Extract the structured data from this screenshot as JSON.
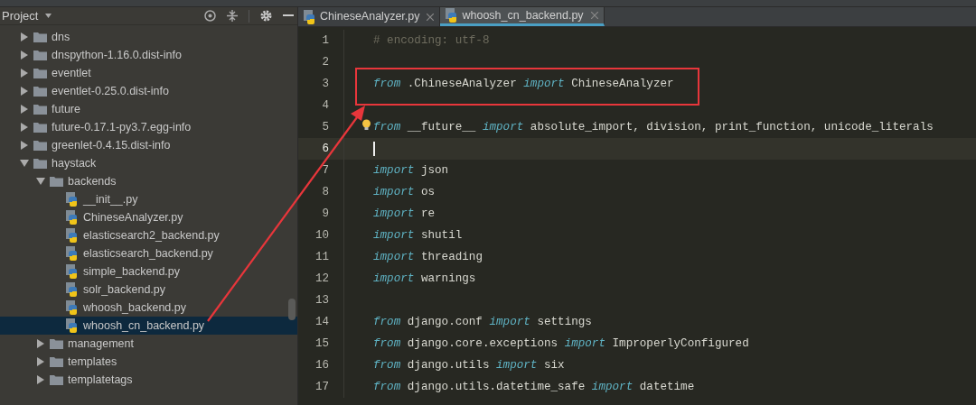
{
  "project_panel": {
    "title": "Project",
    "tree": [
      {
        "label": "dns",
        "kind": "folder",
        "expanded": false
      },
      {
        "label": "dnspython-1.16.0.dist-info",
        "kind": "folder",
        "expanded": false
      },
      {
        "label": "eventlet",
        "kind": "folder",
        "expanded": false
      },
      {
        "label": "eventlet-0.25.0.dist-info",
        "kind": "folder",
        "expanded": false
      },
      {
        "label": "future",
        "kind": "folder",
        "expanded": false
      },
      {
        "label": "future-0.17.1-py3.7.egg-info",
        "kind": "folder",
        "expanded": false
      },
      {
        "label": "greenlet-0.4.15.dist-info",
        "kind": "folder",
        "expanded": false
      },
      {
        "label": "haystack",
        "kind": "folder",
        "expanded": true,
        "children": [
          {
            "label": "backends",
            "kind": "folder",
            "expanded": true,
            "children": [
              {
                "label": "__init__.py",
                "kind": "python",
                "selected": false
              },
              {
                "label": "ChineseAnalyzer.py",
                "kind": "python",
                "selected": false
              },
              {
                "label": "elasticsearch2_backend.py",
                "kind": "python",
                "selected": false
              },
              {
                "label": "elasticsearch_backend.py",
                "kind": "python",
                "selected": false
              },
              {
                "label": "simple_backend.py",
                "kind": "python",
                "selected": false
              },
              {
                "label": "solr_backend.py",
                "kind": "python",
                "selected": false
              },
              {
                "label": "whoosh_backend.py",
                "kind": "python",
                "selected": false
              },
              {
                "label": "whoosh_cn_backend.py",
                "kind": "python",
                "selected": true
              }
            ]
          },
          {
            "label": "management",
            "kind": "folder",
            "expanded": false
          },
          {
            "label": "templates",
            "kind": "folder",
            "expanded": false
          },
          {
            "label": "templatetags",
            "kind": "folder",
            "expanded": false
          }
        ]
      }
    ]
  },
  "tabs": [
    {
      "label": "ChineseAnalyzer.py",
      "selected": false
    },
    {
      "label": "whoosh_cn_backend.py",
      "selected": true
    }
  ],
  "editor": {
    "lines": [
      {
        "number": "1",
        "current": false,
        "tokens": [
          {
            "kind": "comment",
            "text": "# encoding: utf-8"
          }
        ]
      },
      {
        "number": "2",
        "current": false
      },
      {
        "number": "3",
        "current": false,
        "tokens": [
          {
            "kind": "keyword",
            "text": "from"
          },
          {
            "kind": "plain",
            "text": " .ChineseAnalyzer "
          },
          {
            "kind": "keyword",
            "text": "import"
          },
          {
            "kind": "plain",
            "text": " ChineseAnalyzer"
          }
        ]
      },
      {
        "number": "4",
        "current": false
      },
      {
        "number": "5",
        "current": false,
        "tokens": [
          {
            "kind": "keyword",
            "text": "from"
          },
          {
            "kind": "plain",
            "text": " __future__ "
          },
          {
            "kind": "keyword",
            "text": "import"
          },
          {
            "kind": "plain",
            "text": " absolute_import, division, print_function, unicode_literals"
          }
        ]
      },
      {
        "number": "6",
        "current": true
      },
      {
        "number": "7",
        "current": false,
        "tokens": [
          {
            "kind": "keyword",
            "text": "import"
          },
          {
            "kind": "plain",
            "text": " json"
          }
        ]
      },
      {
        "number": "8",
        "current": false,
        "tokens": [
          {
            "kind": "keyword",
            "text": "import"
          },
          {
            "kind": "plain",
            "text": " os"
          }
        ]
      },
      {
        "number": "9",
        "current": false,
        "tokens": [
          {
            "kind": "keyword",
            "text": "import"
          },
          {
            "kind": "plain",
            "text": " re"
          }
        ]
      },
      {
        "number": "10",
        "current": false,
        "tokens": [
          {
            "kind": "keyword",
            "text": "import"
          },
          {
            "kind": "plain",
            "text": " shutil"
          }
        ]
      },
      {
        "number": "11",
        "current": false,
        "tokens": [
          {
            "kind": "keyword",
            "text": "import"
          },
          {
            "kind": "plain",
            "text": " threading"
          }
        ]
      },
      {
        "number": "12",
        "current": false,
        "tokens": [
          {
            "kind": "keyword",
            "text": "import"
          },
          {
            "kind": "plain",
            "text": " warnings"
          }
        ]
      },
      {
        "number": "13",
        "current": false
      },
      {
        "number": "14",
        "current": false,
        "tokens": [
          {
            "kind": "keyword",
            "text": "from"
          },
          {
            "kind": "plain",
            "text": " django.conf "
          },
          {
            "kind": "keyword",
            "text": "import"
          },
          {
            "kind": "plain",
            "text": " settings"
          }
        ]
      },
      {
        "number": "15",
        "current": false,
        "tokens": [
          {
            "kind": "keyword",
            "text": "from"
          },
          {
            "kind": "plain",
            "text": " django.core.exceptions "
          },
          {
            "kind": "keyword",
            "text": "import"
          },
          {
            "kind": "plain",
            "text": " ImproperlyConfigured"
          }
        ]
      },
      {
        "number": "16",
        "current": false,
        "tokens": [
          {
            "kind": "keyword",
            "text": "from"
          },
          {
            "kind": "plain",
            "text": " django.utils "
          },
          {
            "kind": "keyword",
            "text": "import"
          },
          {
            "kind": "plain",
            "text": " six"
          }
        ]
      },
      {
        "number": "17",
        "current": false,
        "tokens": [
          {
            "kind": "keyword",
            "text": "from"
          },
          {
            "kind": "plain",
            "text": " django.utils.datetime_safe "
          },
          {
            "kind": "keyword",
            "text": "import"
          },
          {
            "kind": "plain",
            "text": " datetime"
          }
        ]
      }
    ]
  }
}
